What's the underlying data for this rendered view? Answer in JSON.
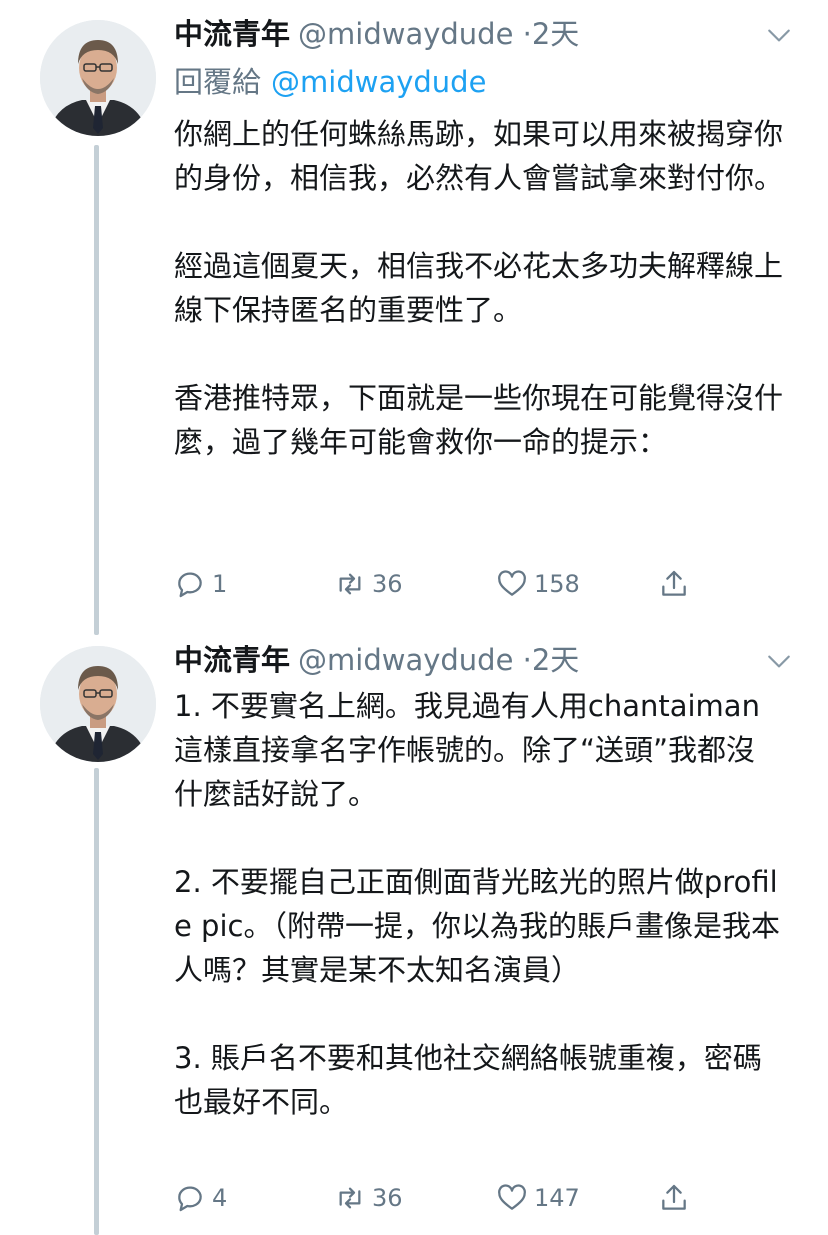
{
  "tweets": [
    {
      "name": "中流青年",
      "handle": "@midwaydude",
      "dot": "·",
      "time": "2天",
      "reply_label": "回覆給",
      "reply_to": "@midwaydude",
      "text": "你網上的任何蛛絲馬跡，如果可以用來被揭穿你的身份，相信我，必然有人會嘗試拿來對付你。\n\n經過這個夏天，相信我不必花太多功夫解釋線上線下保持匿名的重要性了。\n\n香港推特眾，下面就是一些你現在可能覺得沒什麼，過了幾年可能會救你一命的提示：",
      "replies": "1",
      "retweets": "36",
      "likes": "158"
    },
    {
      "name": "中流青年",
      "handle": "@midwaydude",
      "dot": "·",
      "time": "2天",
      "text": "1. 不要實名上網。我見過有人用chantaiman這樣直接拿名字作帳號的。除了“送頭”我都沒什麼話好說了。\n\n2. 不要擺自己正面側面背光眩光的照片做profile pic。（附帶一提，你以為我的賬戶畫像是我本人嗎？其實是某不太知名演員）\n\n3. 賬戶名不要和其他社交網絡帳號重複，密碼也最好不同。",
      "replies": "4",
      "retweets": "36",
      "likes": "147"
    }
  ],
  "colors": {
    "text": "#14171a",
    "secondary": "#657786",
    "link": "#1da1f2",
    "thread_line": "#c4cfd6"
  },
  "icons": [
    "chevron-down-icon",
    "reply-icon",
    "retweet-icon",
    "like-icon",
    "share-icon"
  ]
}
